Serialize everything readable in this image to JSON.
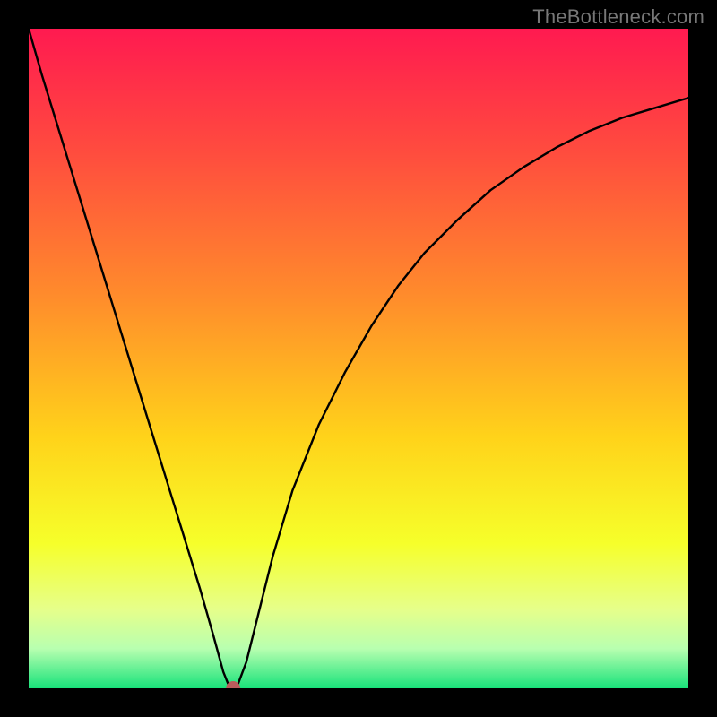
{
  "watermark": "TheBottleneck.com",
  "chart_data": {
    "type": "line",
    "title": "",
    "xlabel": "",
    "ylabel": "",
    "xlim": [
      0,
      100
    ],
    "ylim": [
      0,
      100
    ],
    "grid": false,
    "background_gradient": {
      "stops": [
        {
          "pos": 0,
          "color": "#ff1a50"
        },
        {
          "pos": 18,
          "color": "#ff4a3f"
        },
        {
          "pos": 40,
          "color": "#ff8a2c"
        },
        {
          "pos": 62,
          "color": "#ffd31a"
        },
        {
          "pos": 78,
          "color": "#f6ff2a"
        },
        {
          "pos": 88,
          "color": "#e6ff8a"
        },
        {
          "pos": 94,
          "color": "#b8ffb0"
        },
        {
          "pos": 100,
          "color": "#18e27a"
        }
      ]
    },
    "series": [
      {
        "name": "bottleneck-curve",
        "color": "#000000",
        "x": [
          0,
          2,
          4,
          6,
          8,
          10,
          12,
          14,
          16,
          18,
          20,
          22,
          24,
          26,
          28,
          29.5,
          30.5,
          31.5,
          33,
          35,
          37,
          40,
          44,
          48,
          52,
          56,
          60,
          65,
          70,
          75,
          80,
          85,
          90,
          95,
          100
        ],
        "y": [
          100,
          93,
          86.5,
          80,
          73.5,
          67,
          60.5,
          54,
          47.5,
          41,
          34.5,
          28,
          21.5,
          15,
          8,
          2.5,
          0,
          0,
          4,
          12,
          20,
          30,
          40,
          48,
          55,
          61,
          66,
          71,
          75.5,
          79,
          82,
          84.5,
          86.5,
          88,
          89.5
        ]
      }
    ],
    "marker": {
      "name": "valley-point",
      "x": 31,
      "y": 0,
      "color": "#bb5c5c",
      "radius_px": 8
    }
  }
}
